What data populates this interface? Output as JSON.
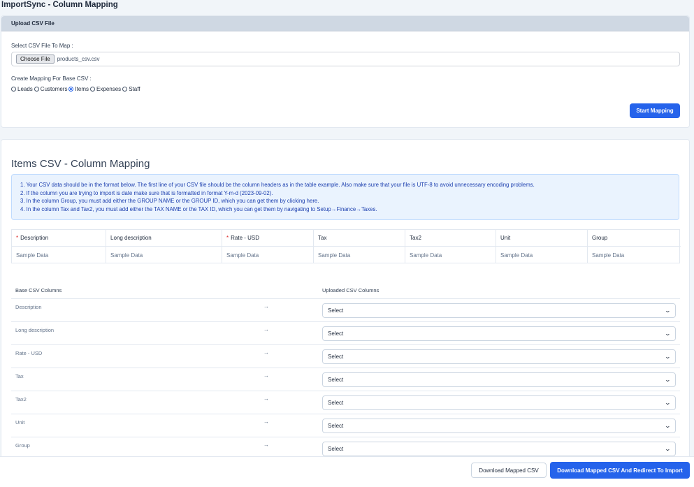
{
  "app": {
    "title": "ImportSync - Column Mapping"
  },
  "upload": {
    "header": "Upload CSV File",
    "file_label": "Select CSV File To Map :",
    "choose_file_label": "Choose File",
    "file_name": "products_csv.csv",
    "base_label": "Create Mapping For Base CSV :",
    "options": [
      {
        "label": "Leads",
        "selected": false
      },
      {
        "label": "Customers",
        "selected": false
      },
      {
        "label": "Items",
        "selected": true
      },
      {
        "label": "Expenses",
        "selected": false
      },
      {
        "label": "Staff",
        "selected": false
      }
    ],
    "start_button": "Start Mapping"
  },
  "mapping": {
    "title": "Items CSV - Column Mapping",
    "notes": [
      "1. Your CSV data should be in the format below. The first line of your CSV file should be the column headers as in the table example. Also make sure that your file is UTF-8 to avoid unnecessary encoding problems.",
      "2. If the column you are trying to import is date make sure that is formatted in format Y-m-d (2023-09-02).",
      "3. In the column Group, you must add either the GROUP NAME or the GROUP ID, which you can get them by clicking here.",
      "4. In the column Tax and Tax2, you must add either the TAX NAME or the TAX ID, which you can get them by navigating to Setup→Finance→Taxes."
    ],
    "sample_headers": [
      {
        "label": "Description",
        "required": true
      },
      {
        "label": "Long description",
        "required": false
      },
      {
        "label": "Rate - USD",
        "required": true
      },
      {
        "label": "Tax",
        "required": false
      },
      {
        "label": "Tax2",
        "required": false
      },
      {
        "label": "Unit",
        "required": false
      },
      {
        "label": "Group",
        "required": false
      }
    ],
    "sample_row": [
      "Sample Data",
      "Sample Data",
      "Sample Data",
      "Sample Data",
      "Sample Data",
      "Sample Data",
      "Sample Data"
    ],
    "base_col_header": "Base CSV Columns",
    "uploaded_col_header": "Uploaded CSV Columns",
    "rows": [
      {
        "base": "Description",
        "selected": "Select"
      },
      {
        "base": "Long description",
        "selected": "Select"
      },
      {
        "base": "Rate - USD",
        "selected": "Select"
      },
      {
        "base": "Tax",
        "selected": "Select"
      },
      {
        "base": "Tax2",
        "selected": "Select"
      },
      {
        "base": "Unit",
        "selected": "Select"
      },
      {
        "base": "Group",
        "selected": "Select"
      }
    ],
    "arrow_glyph": "→",
    "required_marker": "*"
  },
  "footer": {
    "download_button": "Download Mapped CSV",
    "download_redirect_button": "Download Mapped CSV And Redirect To Import"
  },
  "colors": {
    "primary": "#2563eb",
    "header_bg": "#cfd8e3",
    "notice_bg": "#eaf3fe",
    "notice_text": "#1e40af",
    "required": "#dc2626"
  },
  "icons": {
    "select_chevron": "chevron-down-icon",
    "mapping_arrow": "arrow-right-icon"
  }
}
